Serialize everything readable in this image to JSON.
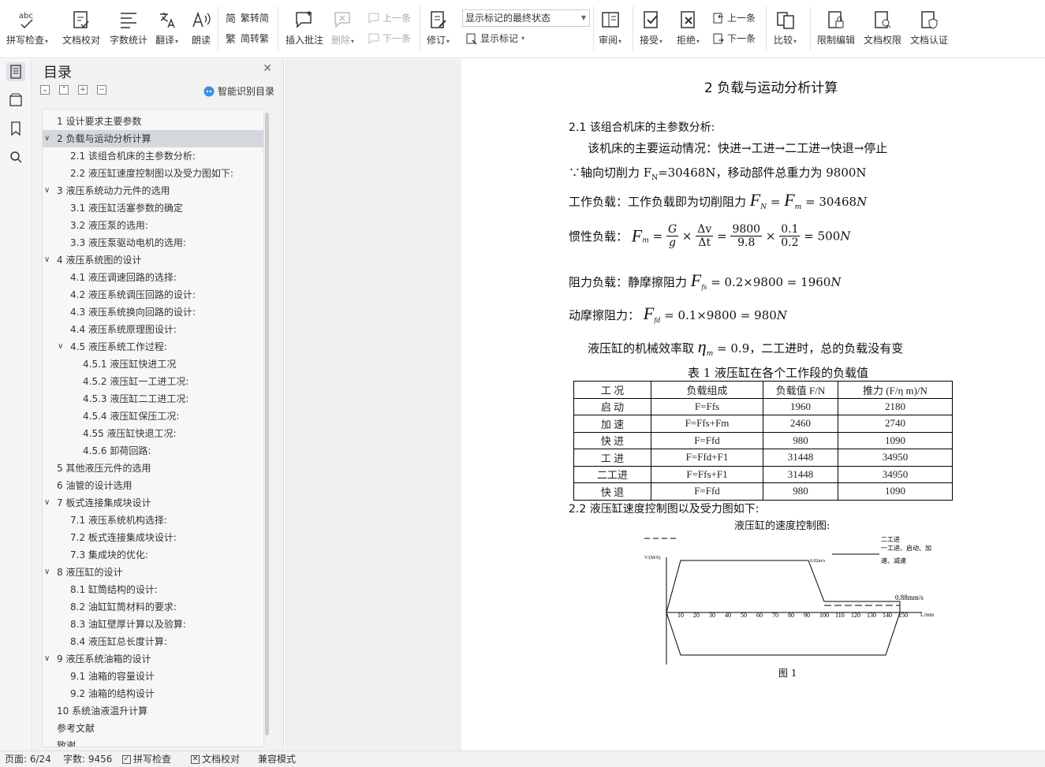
{
  "ribbon": {
    "spell": "拼写检查",
    "proof": "文档校对",
    "wordcount": "字数统计",
    "translate": "翻译",
    "read": "朗读",
    "trad_simp": "繁转简",
    "simp_trad": "简转繁",
    "insert_comment": "插入批注",
    "delete": "删除",
    "prev_c": "上一条",
    "next_c": "下一条",
    "revise": "修订",
    "mark_state": "显示标记的最终状态",
    "show_mark": "显示标记",
    "review": "审阅",
    "accept": "接受",
    "reject": "拒绝",
    "prev": "上一条",
    "next": "下一条",
    "compare": "比较",
    "restrict": "限制编辑",
    "doc_perm": "文档权限",
    "doc_cert": "文档认证",
    "spell_icon_text": "abc"
  },
  "toc": {
    "title": "目录",
    "smart": "智能识别目录",
    "items": [
      {
        "text": "1   设计要求主要参数"
      },
      {
        "text": "2  负载与运动分析计算"
      },
      {
        "text": "2.1    该组合机床的主参数分析:"
      },
      {
        "text": "2.2    液压缸速度控制图以及受力图如下:"
      },
      {
        "text": "3    液压系统动力元件的选用"
      },
      {
        "text": "3.1    液压缸活塞参数的确定"
      },
      {
        "text": "3.2    液压泵的选用:"
      },
      {
        "text": "3.3      液压泵驱动电机的选用:"
      },
      {
        "text": "4    液压系统图的设计"
      },
      {
        "text": "4.1    液压调速回路的选择:"
      },
      {
        "text": "4.2    液压系统调压回路的设计:"
      },
      {
        "text": "4.3    液压系统换向回路的设计:"
      },
      {
        "text": "4.4    液压系统原理图设计:"
      },
      {
        "text": "4.5 液压系统工作过程:"
      },
      {
        "text": "4.5.1  液压缸快进工况"
      },
      {
        "text": "4.5.2  液压缸一工进工况:"
      },
      {
        "text": "4.5.3 液压缸二工进工况:"
      },
      {
        "text": "4.5.4  液压缸保压工况:"
      },
      {
        "text": "4.55  液压缸快退工况:"
      },
      {
        "text": "4.5.6  卸荷回路:"
      },
      {
        "text": "5    其他液压元件的选用"
      },
      {
        "text": "6    油管的设计选用"
      },
      {
        "text": "7    板式连接集成块设计"
      },
      {
        "text": "7.1  液压系统机构选择:"
      },
      {
        "text": "7.2    板式连接集成块设计:"
      },
      {
        "text": "7.3 集成块的优化:"
      },
      {
        "text": "8    液压缸的设计"
      },
      {
        "text": "8.1    缸筒结构的设计:"
      },
      {
        "text": "8.2    油缸缸筒材料的要求:"
      },
      {
        "text": "8.3    油缸壁厚计算以及验算:"
      },
      {
        "text": "8.4    液压缸总长度计算:"
      },
      {
        "text": "9  液压系统油箱的设计"
      },
      {
        "text": "9.1    油箱的容量设计"
      },
      {
        "text": "9.2    油箱的结构设计"
      },
      {
        "text": "10    系统油液温升计算"
      },
      {
        "text": "参考文献"
      },
      {
        "text": "致谢"
      }
    ]
  },
  "doc": {
    "heading": "2  负载与运动分析计算",
    "s21": "2.1    该组合机床的主参数分析:",
    "motion": "该机床的主要运动情况：快进→工进→二工进→快退→停止",
    "axial_pre": "∵轴向切削力 F",
    "axial_sub": "N",
    "axial_post": "=30468N，移动部件总重力为 9800N",
    "work_label": "工作负载：工作负载即为切削阻力",
    "work_eq": "= 30468",
    "inertia_label": "惯性负载：",
    "inertia_g": "G",
    "inertia_gd": "g",
    "inertia_dv": "Δv",
    "inertia_dt": "Δt",
    "inertia_n": "9800",
    "inertia_d": "9.8",
    "inertia_n2": "0.1",
    "inertia_d2": "0.2",
    "inertia_res": "= 500",
    "res_label": "阻力负载：静摩擦阻力",
    "res_eq": "= 0.2×9800 = 1960",
    "dyn_label": "动摩擦阻力：",
    "dyn_eq": "= 0.1×9800 = 980",
    "eff_pre": "液压缸的机械效率取",
    "eff_post": "= 0.9，二工进时，总的负载没有变",
    "unit": "N",
    "sym_F": "F",
    "sub_N": "N",
    "sub_m": "m",
    "sub_fs": "fs",
    "sub_fd": "fd",
    "sym_eta": "η",
    "table_caption": "表 1     液压缸在各个工作段的负载值",
    "table_head": [
      "工  况",
      "负载组成",
      "负载值 F/N",
      "推力  (F/η m)/N"
    ],
    "table_rows": [
      [
        "启  动",
        "F=Ffs",
        "1960",
        "2180"
      ],
      [
        "加  速",
        "F=Ffs+Fm",
        "2460",
        "2740"
      ],
      [
        "快  进",
        "F=Ffd",
        "980",
        "1090"
      ],
      [
        "工  进",
        "F=Ffd+F1",
        "31448",
        "34950"
      ],
      [
        "二工进",
        "F=Ffs+F1",
        "31448",
        "34950"
      ],
      [
        "快  退",
        "F=Ffd",
        "980",
        "1090"
      ]
    ],
    "s22": "2.2    液压缸速度控制图以及受力图如下:",
    "diagram_title": "液压缸的速度控制图:",
    "legend1": "二工进",
    "legend2": "一工进、启动、加",
    "legend3": "速、减速",
    "v_label": "V/(M/S)",
    "v_peak": "0.02m/s",
    "v_low": "0.88mm/s",
    "x_label": "L/mm",
    "x_ticks": [
      "10",
      "20",
      "30",
      "40",
      "50",
      "60",
      "70",
      "80",
      "90",
      "100",
      "110",
      "120",
      "130",
      "140",
      "150"
    ],
    "fig": "图 1"
  },
  "status": {
    "page": "页面: 6/24",
    "words": "字数: 9456",
    "spell": "拼写检查",
    "proof": "文档校对",
    "compat": "兼容模式"
  }
}
